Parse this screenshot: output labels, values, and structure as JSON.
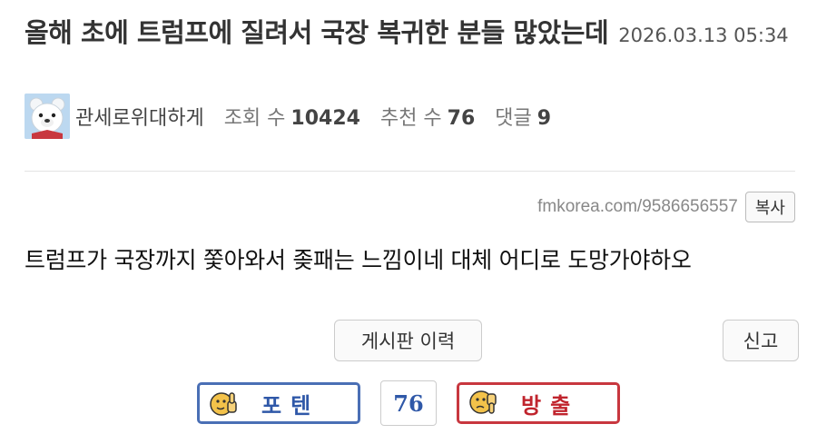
{
  "post": {
    "title": "올해 초에 트럼프에 질려서 국장 복귀한 분들 많았는데",
    "date": "2026.03.13 05:34",
    "author": "관세로위대하게",
    "views_label": "조회 수",
    "views": "10424",
    "recommends_label": "추천 수",
    "recommends": "76",
    "comments_label": "댓글",
    "comments": "9",
    "url": "fmkorea.com/9586656557",
    "copy_label": "복사",
    "body": "트럼프가 국장까지 쫓아와서 좆패는 느낌이네 대체 어디로 도망가야하오"
  },
  "actions": {
    "history_label": "게시판 이력",
    "report_label": "신고"
  },
  "vote": {
    "up_label": "포텐",
    "count": "76",
    "down_label": "방출"
  },
  "colors": {
    "up": "#4a6fb5",
    "down": "#c8373f",
    "face": "#f3c24a"
  },
  "icons": {
    "avatar": "polar-bear-avatar",
    "up": "thumbs-up-face-icon",
    "down": "thumbs-down-face-icon"
  }
}
